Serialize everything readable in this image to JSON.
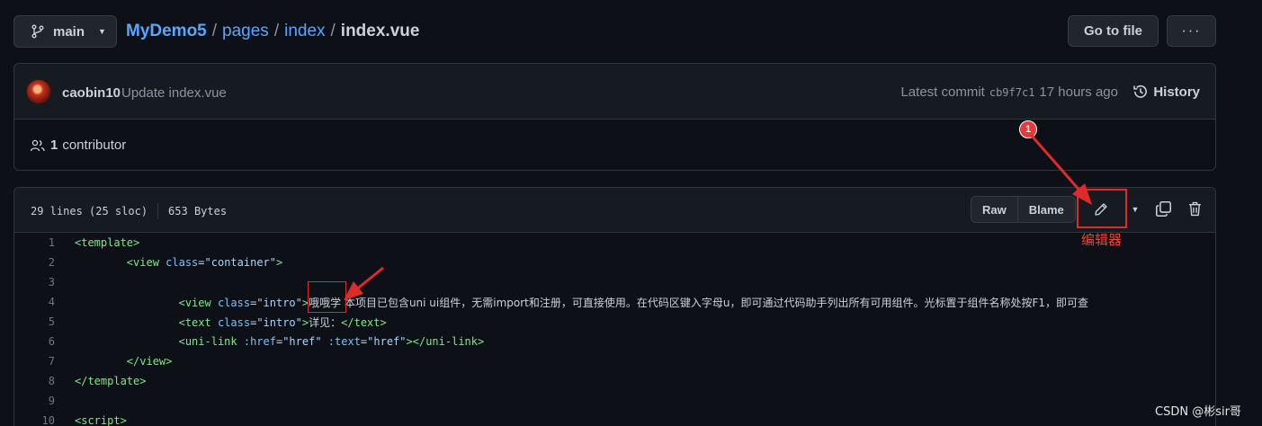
{
  "branch": {
    "label": "main"
  },
  "breadcrumb": {
    "repo": "MyDemo5",
    "sep": "/",
    "dir1": "pages",
    "dir2": "index",
    "file": "index.vue"
  },
  "header": {
    "goto_label": "Go to file",
    "more_label": "···"
  },
  "commit": {
    "author": "caobin10",
    "message": "Update index.vue",
    "latest_prefix": "Latest commit",
    "sha": "cb9f7c1",
    "time": "17 hours ago",
    "history_label": "History"
  },
  "contributors": {
    "count": "1",
    "label": "contributor"
  },
  "file": {
    "lines_info": "29 lines (25 sloc)",
    "size": "653 Bytes",
    "raw_label": "Raw",
    "blame_label": "Blame"
  },
  "code": {
    "lines": [
      {
        "n": "1",
        "indent": "",
        "parts": [
          [
            "tag",
            "<template>"
          ]
        ]
      },
      {
        "n": "2",
        "indent": "\t",
        "parts": [
          [
            "tag",
            "<view "
          ],
          [
            "attr",
            "class"
          ],
          [
            "txt",
            "="
          ],
          [
            "str",
            "\"container\""
          ],
          [
            "tag",
            ">"
          ]
        ]
      },
      {
        "n": "3",
        "indent": "",
        "parts": []
      },
      {
        "n": "4",
        "indent": "\t\t",
        "parts": [
          [
            "tag",
            "<view "
          ],
          [
            "attr",
            "class"
          ],
          [
            "txt",
            "="
          ],
          [
            "str",
            "\"intro\""
          ],
          [
            "tag",
            ">"
          ],
          [
            "cjk",
            "哦哦学 本项目已包含uni ui组件，无需import和注册，可直接使用。在代码区键入字母u，即可通过代码助手列出所有可用组件。光标置于组件名称处按F1，即可查"
          ]
        ]
      },
      {
        "n": "5",
        "indent": "\t\t",
        "parts": [
          [
            "tag",
            "<text "
          ],
          [
            "attr",
            "class"
          ],
          [
            "txt",
            "="
          ],
          [
            "str",
            "\"intro\""
          ],
          [
            "tag",
            ">"
          ],
          [
            "cjk",
            "详见："
          ],
          [
            "tag",
            "</text>"
          ]
        ]
      },
      {
        "n": "6",
        "indent": "\t\t",
        "parts": [
          [
            "tag",
            "<uni-link "
          ],
          [
            "attr",
            ":href"
          ],
          [
            "txt",
            "="
          ],
          [
            "str",
            "\"href\""
          ],
          [
            "txt",
            " "
          ],
          [
            "attr",
            ":text"
          ],
          [
            "txt",
            "="
          ],
          [
            "str",
            "\"href\""
          ],
          [
            "tag",
            "></uni-link>"
          ]
        ]
      },
      {
        "n": "7",
        "indent": "\t",
        "parts": [
          [
            "tag",
            "</view>"
          ]
        ]
      },
      {
        "n": "8",
        "indent": "",
        "parts": [
          [
            "tag",
            "</template>"
          ]
        ]
      },
      {
        "n": "9",
        "indent": "",
        "parts": []
      },
      {
        "n": "10",
        "indent": "",
        "parts": [
          [
            "tag",
            "<script>"
          ]
        ]
      }
    ]
  },
  "annotations": {
    "badge": "1",
    "editor_label": "编辑器"
  },
  "watermark": "CSDN @彬sir哥",
  "colors": {
    "background": "#0d1117",
    "panel": "#161b22",
    "link": "#58a6ff",
    "annotation_red": "#e02a2a"
  },
  "icons": [
    "git-branch-icon",
    "people-icon",
    "history-icon",
    "pencil-icon",
    "copy-icon",
    "trash-icon"
  ]
}
